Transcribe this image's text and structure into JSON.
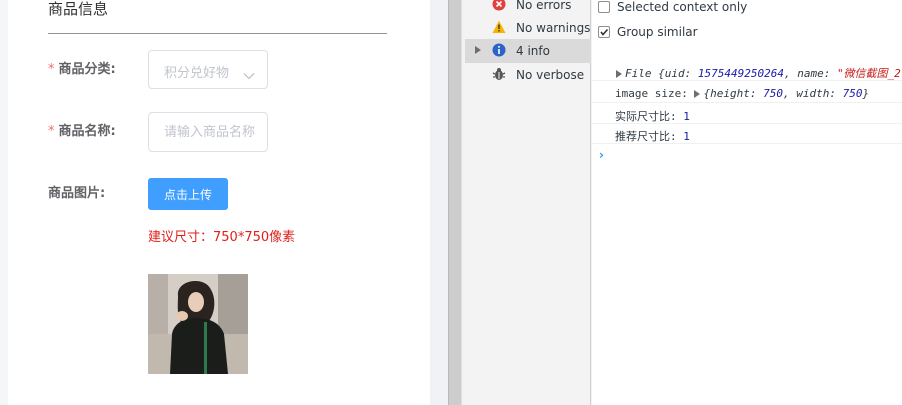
{
  "form": {
    "section_title": "商品信息",
    "category": {
      "label": "商品分类:",
      "required_mark": "*",
      "value": "积分兑好物"
    },
    "name": {
      "label": "商品名称:",
      "required_mark": "*",
      "placeholder": "请输入商品名称"
    },
    "image": {
      "label": "商品图片:",
      "upload_button": "点击上传",
      "size_hint": "建议尺寸：750*750像素"
    }
  },
  "devtools": {
    "sidebar": [
      {
        "label": "No errors",
        "icon": "error-icon"
      },
      {
        "label": "No warnings",
        "icon": "warning-icon"
      },
      {
        "label": "4 info",
        "icon": "info-icon",
        "selected": true
      },
      {
        "label": "No verbose",
        "icon": "verbose-bug-icon"
      }
    ],
    "options": {
      "selected_context_only": {
        "label": "Selected context only",
        "checked": false
      },
      "group_similar": {
        "label": "Group similar",
        "checked": true
      }
    },
    "console": {
      "line1": {
        "prefix": "File {uid: ",
        "uid": "1575449250264",
        "mid": ", name: ",
        "name": "\"微信截图_2"
      },
      "line2": {
        "label": "image size: ",
        "obj_prefix": "{height: ",
        "height": "750",
        "obj_mid": ", width: ",
        "width": "750",
        "obj_suffix": "}"
      },
      "line3": {
        "label": "实际尺寸比: ",
        "value": "1"
      },
      "line4": {
        "label": "推荐尺寸比: ",
        "value": "1"
      },
      "prompt": "›"
    }
  },
  "colors": {
    "primary": "#409eff",
    "danger": "#e0201b",
    "required": "#f56c6c"
  }
}
